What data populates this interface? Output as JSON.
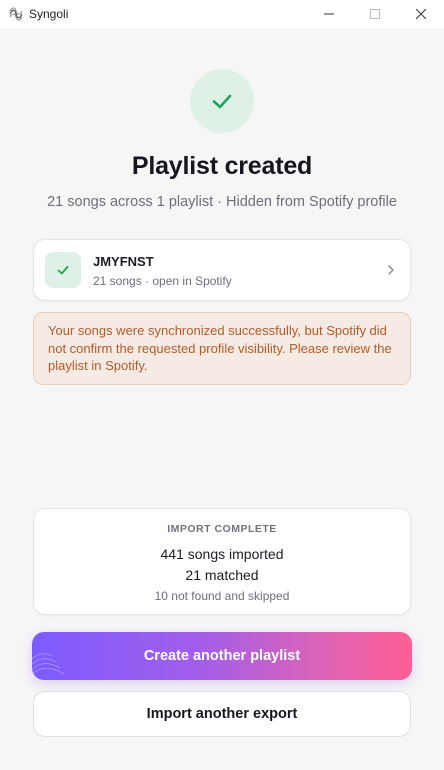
{
  "window": {
    "title": "Syngoli"
  },
  "hero": {
    "title": "Playlist created",
    "subtitle": "21 songs across 1 playlist · Hidden from Spotify profile"
  },
  "playlist": {
    "name": "JMYFNST",
    "meta": "21 songs · open in Spotify"
  },
  "warning": {
    "text": "Your songs were synchronized successfully, but Spotify did not confirm the requested profile visibility. Please review the playlist in Spotify."
  },
  "import_summary": {
    "label": "IMPORT COMPLETE",
    "imported": "441 songs imported",
    "matched": "21 matched",
    "skipped": "10 not found and skipped"
  },
  "actions": {
    "primary_label": "Create another playlist",
    "secondary_label": "Import another export"
  },
  "colors": {
    "success": "#22a454",
    "success_bg": "#dff1e6",
    "warning_text": "#b45a27",
    "warning_bg": "#f6ebe4",
    "gradient_start": "#7b5cff",
    "gradient_end": "#ff5e94"
  }
}
